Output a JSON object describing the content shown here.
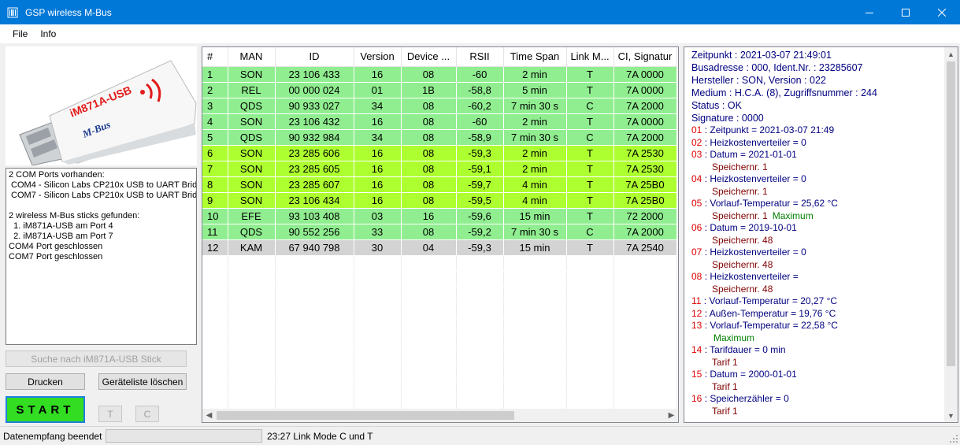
{
  "window": {
    "title": "GSP wireless M-Bus",
    "icon": "barcode-app-icon"
  },
  "menu": {
    "items": [
      "File",
      "Info"
    ]
  },
  "device": {
    "label": "iM871A-USB",
    "brand": "M-Bus"
  },
  "log": {
    "text": "2 COM Ports vorhanden:\n COM4 - Silicon Labs CP210x USB to UART Bridge\n COM7 - Silicon Labs CP210x USB to UART Bridge\n\n2 wireless M-Bus sticks gefunden:\n  1. iM871A-USB am Port 4\n  2. iM871A-USB am Port 7\nCOM4 Port geschlossen\nCOM7 Port geschlossen"
  },
  "buttons": {
    "search": "Suche nach iM871A-USB Stick",
    "print": "Drucken",
    "clear": "Geräteliste löschen",
    "start": "START",
    "t": "T",
    "c": "C"
  },
  "table": {
    "headers": [
      "#",
      "MAN",
      "ID",
      "Version",
      "Device ...",
      "RSII",
      "Time Span",
      "Link M...",
      "CI, Signatur"
    ],
    "rows": [
      {
        "cells": [
          "1",
          "SON",
          "23 106 433",
          "16",
          "08",
          "-60",
          "2 min",
          "T",
          "7A 0000"
        ],
        "color": "green"
      },
      {
        "cells": [
          "2",
          "REL",
          "00 000 024",
          "01",
          "1B",
          "-58,8",
          "5 min",
          "T",
          "7A 0000"
        ],
        "color": "green"
      },
      {
        "cells": [
          "3",
          "QDS",
          "90 933 027",
          "34",
          "08",
          "-60,2",
          "7 min 30 s",
          "C",
          "7A 2000"
        ],
        "color": "green"
      },
      {
        "cells": [
          "4",
          "SON",
          "23 106 432",
          "16",
          "08",
          "-60",
          "2 min",
          "T",
          "7A 0000"
        ],
        "color": "green"
      },
      {
        "cells": [
          "5",
          "QDS",
          "90 932 984",
          "34",
          "08",
          "-58,9",
          "7 min 30 s",
          "C",
          "7A 2000"
        ],
        "color": "green"
      },
      {
        "cells": [
          "6",
          "SON",
          "23 285 606",
          "16",
          "08",
          "-59,3",
          "2 min",
          "T",
          "7A 2530"
        ],
        "color": "lime"
      },
      {
        "cells": [
          "7",
          "SON",
          "23 285 605",
          "16",
          "08",
          "-59,1",
          "2 min",
          "T",
          "7A 2530"
        ],
        "color": "lime"
      },
      {
        "cells": [
          "8",
          "SON",
          "23 285 607",
          "16",
          "08",
          "-59,7",
          "4 min",
          "T",
          "7A 25B0"
        ],
        "color": "lime"
      },
      {
        "cells": [
          "9",
          "SON",
          "23 106 434",
          "16",
          "08",
          "-59,5",
          "4 min",
          "T",
          "7A 25B0"
        ],
        "color": "lime"
      },
      {
        "cells": [
          "10",
          "EFE",
          "93 103 408",
          "03",
          "16",
          "-59,6",
          "15 min",
          "T",
          "72 2000"
        ],
        "color": "green"
      },
      {
        "cells": [
          "11",
          "QDS",
          "90 552 256",
          "33",
          "08",
          "-59,2",
          "7 min 30 s",
          "C",
          "7A 2000"
        ],
        "color": "green"
      },
      {
        "cells": [
          "12",
          "KAM",
          "67 940 798",
          "30",
          "04",
          "-59,3",
          "15 min",
          "T",
          "7A 2540"
        ],
        "color": "gray"
      }
    ],
    "row_colors": {
      "green": "#90ee90",
      "lime": "#adff2f",
      "gray": "#d3d3d3"
    }
  },
  "detail": {
    "header": [
      "Zeitpunkt : 2021-03-07 21:49:01",
      "Busadresse : 000, Ident.Nr. : 23285607",
      "Hersteller : SON, Version : 022",
      "Medium : H.C.A. (8), Zugriffsnummer : 244",
      "Status : OK",
      "Signature : 0000"
    ],
    "records": [
      {
        "num": "01",
        "text": "Zeitpunkt = 2021-03-07 21:49"
      },
      {
        "num": "02",
        "text": "Heizkostenverteiler = 0"
      },
      {
        "num": "03",
        "text": "Datum = 2021-01-01"
      },
      {
        "sub": "Speichernr. 1"
      },
      {
        "num": "04",
        "text": "Heizkostenverteiler = 0"
      },
      {
        "sub": "Speichernr. 1"
      },
      {
        "num": "05",
        "text": "Vorlauf-Temperatur = 25,62 °C"
      },
      {
        "sub": "Speichernr. 1",
        "extra": "Maximum"
      },
      {
        "num": "06",
        "text": "Datum = 2019-10-01"
      },
      {
        "sub": "Speichernr. 48"
      },
      {
        "num": "07",
        "text": "Heizkostenverteiler = 0"
      },
      {
        "sub": "Speichernr. 48"
      },
      {
        "num": "08",
        "text": "Heizkostenverteiler ="
      },
      {
        "sub": "Speichernr. 48"
      },
      {
        "num": "11",
        "text": "Vorlauf-Temperatur = 20,27 °C"
      },
      {
        "num": "12",
        "text": "Außen-Temperatur = 19,76 °C"
      },
      {
        "num": "13",
        "text": "Vorlauf-Temperatur = 22,58 °C"
      },
      {
        "extra": "Maximum"
      },
      {
        "num": "14",
        "text": "Tarifdauer = 0 min"
      },
      {
        "sub": "Tarif 1"
      },
      {
        "num": "15",
        "text": "Datum = 2000-01-01"
      },
      {
        "sub": "Tarif 1"
      },
      {
        "num": "16",
        "text": "Speicherzähler = 0"
      },
      {
        "sub": "Tarif 1"
      }
    ]
  },
  "status": {
    "left": "Datenempfang beendet",
    "right": "23:27  Link Mode C und T"
  }
}
